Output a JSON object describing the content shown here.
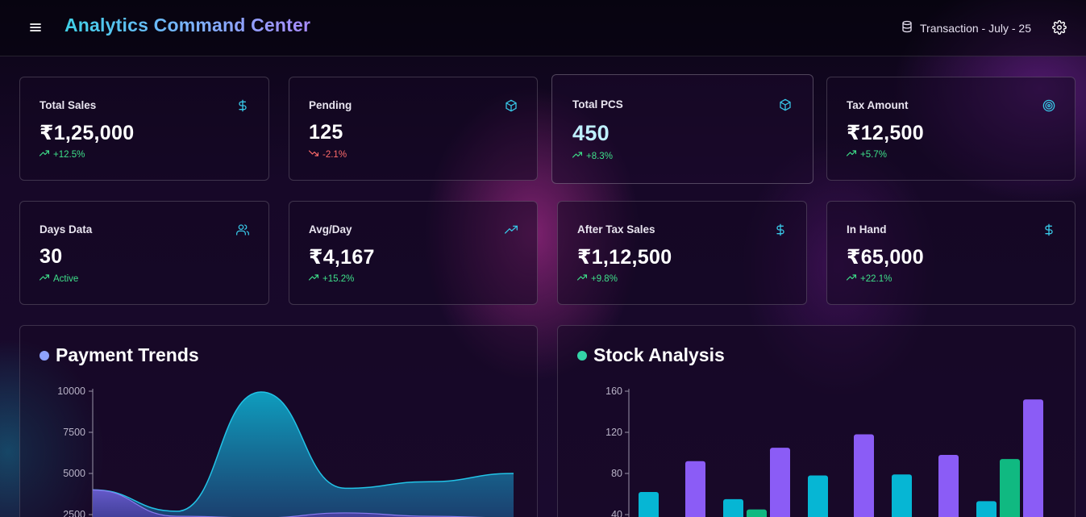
{
  "header": {
    "title": "Analytics Command Center",
    "menu_icon": "menu-icon",
    "transaction_label": "Transaction - July - 25",
    "database_icon": "database-icon",
    "settings_icon": "gear-icon"
  },
  "cards": [
    {
      "label": "Total Sales",
      "value": "₹1,25,000",
      "trend": "+12.5%",
      "trend_dir": "up",
      "icon": "dollar-icon"
    },
    {
      "label": "Pending",
      "value": "125",
      "trend": "-2.1%",
      "trend_dir": "down",
      "icon": "box-icon"
    },
    {
      "label": "Total PCS",
      "value": "450",
      "trend": "+8.3%",
      "trend_dir": "up",
      "icon": "box-icon"
    },
    {
      "label": "Tax Amount",
      "value": "₹12,500",
      "trend": "+5.7%",
      "trend_dir": "up",
      "icon": "target-icon"
    },
    {
      "label": "Days Data",
      "value": "30",
      "trend": "Active",
      "trend_dir": "up",
      "icon": "users-icon"
    },
    {
      "label": "Avg/Day",
      "value": "₹4,167",
      "trend": "+15.2%",
      "trend_dir": "up",
      "icon": "trending-up-icon"
    },
    {
      "label": "After Tax Sales",
      "value": "₹1,12,500",
      "trend": "+9.8%",
      "trend_dir": "up",
      "icon": "dollar-icon"
    },
    {
      "label": "In Hand",
      "value": "₹65,000",
      "trend": "+22.1%",
      "trend_dir": "up",
      "icon": "dollar-icon"
    }
  ],
  "colors": {
    "up": "#3ee08a",
    "down": "#ff6b6b",
    "icon": "#38c8e8",
    "payment_dot": "#8ea2ff",
    "stock_dot": "#34d3a8",
    "series_cyan": "#06b6d4",
    "series_purple": "#8b5cf6",
    "series_green": "#10b981"
  },
  "panels": {
    "payment_trends": {
      "title": "Payment Trends"
    },
    "stock_analysis": {
      "title": "Stock Analysis"
    }
  },
  "chart_data": [
    {
      "type": "area",
      "title": "Payment Trends",
      "ylim": [
        2500,
        10000
      ],
      "yticks": [
        2500,
        5000,
        7500,
        10000
      ],
      "grid": false,
      "x": [
        0,
        1,
        2,
        3,
        4,
        5
      ],
      "series": [
        {
          "values": [
            4000,
            2700,
            9950,
            4100,
            4500,
            5000
          ]
        },
        {
          "values": [
            2500,
            2400,
            2300,
            2600,
            2400,
            2300
          ]
        }
      ]
    },
    {
      "type": "bar",
      "title": "Stock Analysis",
      "ylim": [
        40,
        160
      ],
      "yticks": [
        40,
        80,
        120,
        160
      ],
      "grid": false,
      "groups": [
        [
          {
            "series": 0,
            "value": 62
          }
        ],
        [
          {
            "series": 2,
            "value": 92
          }
        ],
        [
          {
            "series": 0,
            "value": 55
          },
          {
            "series": 1,
            "value": 45
          },
          {
            "series": 2,
            "value": 105
          }
        ],
        [
          {
            "series": 0,
            "value": 78
          }
        ],
        [
          {
            "series": 2,
            "value": 118
          }
        ],
        [
          {
            "series": 0,
            "value": 79
          }
        ],
        [
          {
            "series": 2,
            "value": 98
          }
        ],
        [
          {
            "series": 0,
            "value": 53
          },
          {
            "series": 1,
            "value": 94
          },
          {
            "series": 2,
            "value": 152
          }
        ]
      ]
    }
  ]
}
